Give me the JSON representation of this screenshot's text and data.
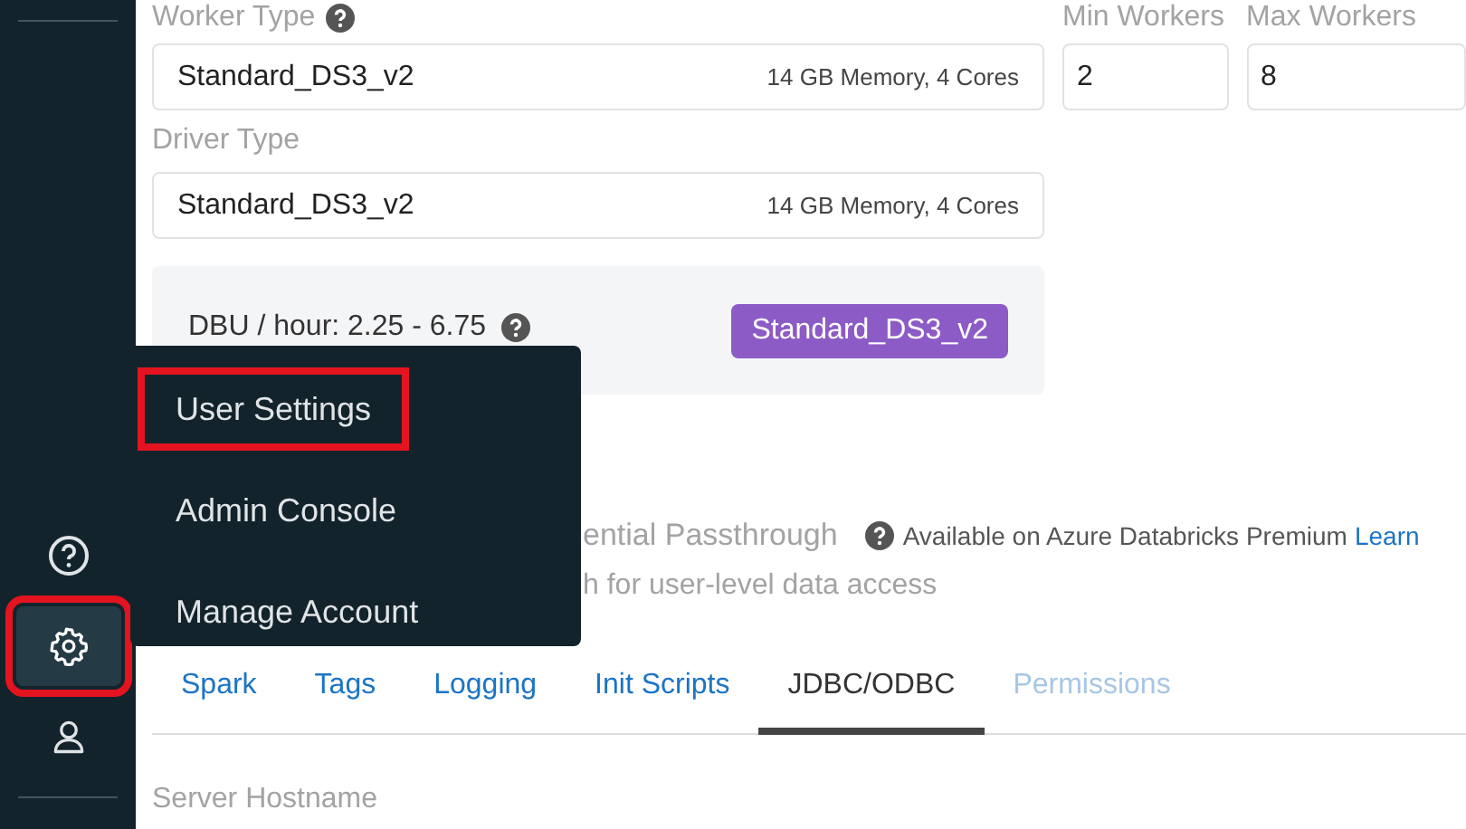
{
  "worker": {
    "label": "Worker Type",
    "value": "Standard_DS3_v2",
    "spec": "14 GB Memory, 4 Cores"
  },
  "min_workers": {
    "label": "Min Workers",
    "value": "2"
  },
  "max_workers": {
    "label": "Max Workers",
    "value": "8"
  },
  "driver": {
    "label": "Driver Type",
    "value": "Standard_DS3_v2",
    "spec": "14 GB Memory, 4 Cores"
  },
  "summary": {
    "dbu": "DBU / hour: 2.25 - 6.75",
    "badge": "Standard_DS3_v2"
  },
  "passthrough": {
    "title": "ential Passthrough",
    "note": "Available on Azure Databricks Premium",
    "link": "Learn",
    "desc": "h for user-level data access"
  },
  "tabs": [
    {
      "label": "Spark",
      "selected": false,
      "disabled": false
    },
    {
      "label": "Tags",
      "selected": false,
      "disabled": false
    },
    {
      "label": "Logging",
      "selected": false,
      "disabled": false
    },
    {
      "label": "Init Scripts",
      "selected": false,
      "disabled": false
    },
    {
      "label": "JDBC/ODBC",
      "selected": true,
      "disabled": false
    },
    {
      "label": "Permissions",
      "selected": false,
      "disabled": true
    }
  ],
  "field_label": "Server Hostname",
  "sidebar": {
    "items": [
      {
        "kind": "help",
        "selected": false
      },
      {
        "kind": "settings",
        "selected": true
      },
      {
        "kind": "user",
        "selected": false
      }
    ]
  },
  "menu": {
    "items": [
      {
        "label": "User Settings",
        "highlighted": true
      },
      {
        "label": "Admin Console",
        "highlighted": false
      },
      {
        "label": "Manage Account",
        "highlighted": false
      }
    ]
  }
}
